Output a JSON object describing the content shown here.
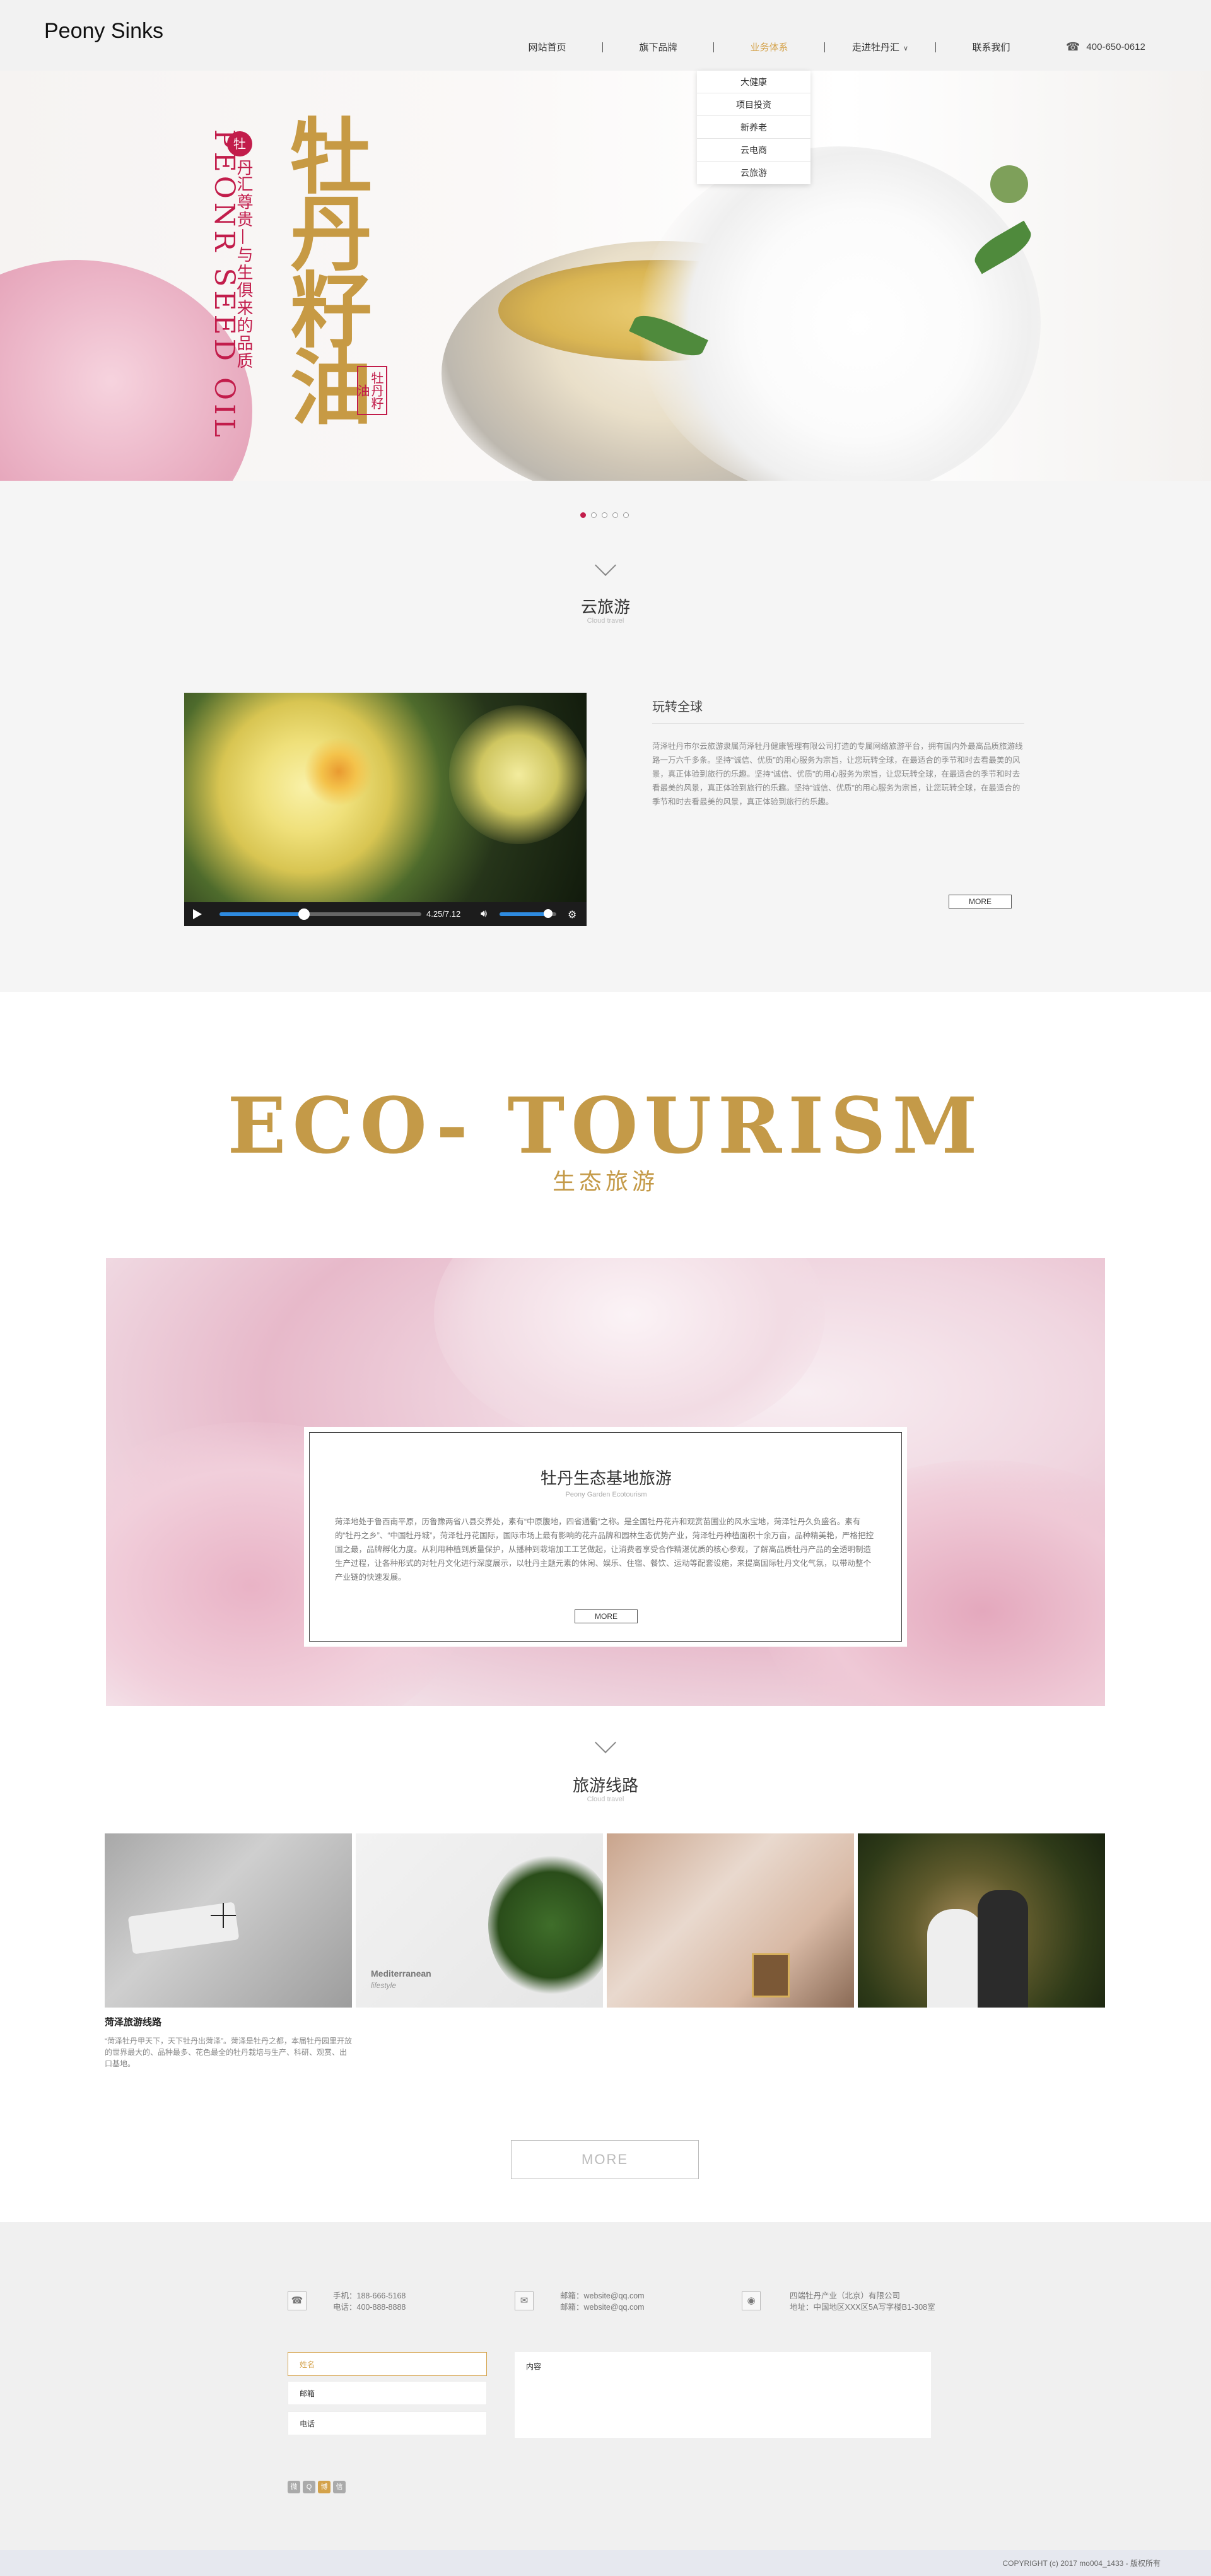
{
  "header": {
    "logo": "Peony Sinks",
    "nav": [
      "网站首页",
      "旗下品牌",
      "业务体系",
      "走进牡丹汇",
      "联系我们"
    ],
    "active_index": 2,
    "phone": "400-650-0612"
  },
  "dropdown": [
    "大健康",
    "项目投资",
    "新养老",
    "云电商",
    "云旅游"
  ],
  "hero": {
    "brand_circle": "牡",
    "brand_rest": "丹汇",
    "tagline": "尊贵—与生俱来的品质",
    "english": "PEONR SEED OIL",
    "title": "牡丹籽油",
    "seal": "牡丹籽油"
  },
  "carousel": {
    "count": 5,
    "active": 0
  },
  "cloud_tour": {
    "title": "云旅游",
    "subtitle": "Cloud travel",
    "intro_title": "玩转全球",
    "intro_text": "菏泽牡丹市尔云旅游隶属菏泽牡丹健康管理有限公司打造的专属网络旅游平台，拥有国内外最高品质旅游线路一万六千多条。坚持“诚信、优质”的用心服务为宗旨，让您玩转全球，在最适合的季节和时去看最美的风景，真正体验到旅行的乐趣。坚持“诚信、优质”的用心服务为宗旨，让您玩转全球，在最适合的季节和时去看最美的风景，真正体验到旅行的乐趣。坚持“诚信、优质”的用心服务为宗旨，让您玩转全球，在最适合的季节和时去看最美的风景，真正体验到旅行的乐趣。",
    "more": "MORE",
    "video": {
      "time": "4.25/7.12",
      "progress": 0.42,
      "volume": 0.85
    }
  },
  "eco": {
    "title": "ECO- TOURISM",
    "subtitle": "生态旅游",
    "card_title": "牡丹生态基地旅游",
    "card_subtitle": "Peony Garden Ecotourism",
    "card_text": "菏泽地处于鲁西南平原，历鲁豫两省八县交界处，素有“中原腹地，四省通衢”之称。是全国牡丹花卉和观赏苗圃业的风水宝地，菏泽牡丹久负盛名。素有的“牡丹之乡”、“中国牡丹城”，菏泽牡丹花国际，国际市场上最有影响的花卉品牌和园林生态优势产业，菏泽牡丹种植面积十余万亩，品种精美艳，严格把控国之最，品牌孵化力度。从利用种植到质量保护，从播种到栽培加工工艺做起，让消费者享受合作精湛优质的核心参观，了解高品质牡丹产品的全透明制造生产过程，让各种形式的对牡丹文化进行深度展示，以牡丹主题元素的休闲、娱乐、住宿、餐饮、运动等配套设施，来提高国际牡丹文化气氛，以带动整个产业链的快速发展。",
    "more": "MORE"
  },
  "routes": {
    "title": "旅游线路",
    "subtitle": "Cloud travel",
    "caption_title": "菏泽旅游线路",
    "caption_text": "“菏泽牡丹甲天下，天下牡丹出菏泽”。菏泽是牡丹之都，本届牡丹园里开放的世界最大的、品种最多、花色最全的牡丹栽培与生产、科研、观赏、出口基地。",
    "card_image_text": "Mediterranean",
    "card_image_sub": "lifestyle",
    "more": "MORE"
  },
  "footer": {
    "contact1": [
      "手机：188-666-5168",
      "电话：400-888-8888"
    ],
    "contact2": [
      "邮箱：website@qq.com",
      "邮箱：website@qq.com"
    ],
    "company": [
      "四端牡丹产业（北京）有限公司",
      "地址：中国地区XXX区5A写字楼B1-308室"
    ],
    "fields": [
      "姓名",
      "邮箱",
      "电话"
    ],
    "message_label": "内容",
    "social": [
      "微",
      "Q",
      "博",
      "信"
    ],
    "copyright": "COPYRIGHT (c) 2017 mo004_1433 - 版权所有"
  },
  "colors": {
    "accent": "#d4a24a",
    "brand_red": "#c21d4b",
    "gold": "#c49a48"
  }
}
